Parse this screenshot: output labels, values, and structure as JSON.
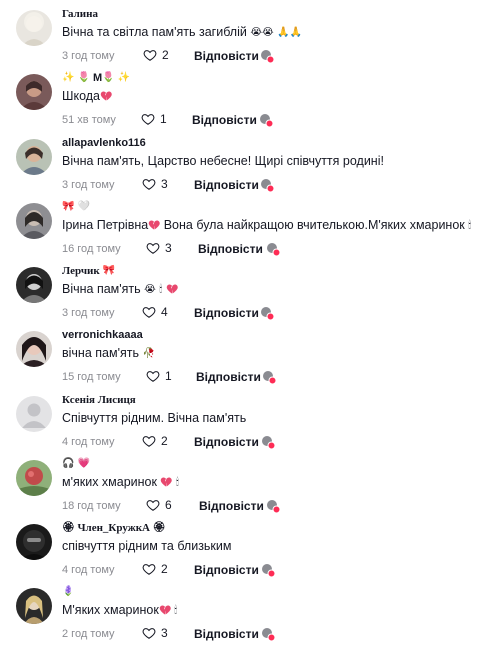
{
  "comments": [
    {
      "name": "Галина",
      "text": "Вічна та світла пам'ять загиблій",
      "time": "3 год тому",
      "likes": "2",
      "reply": "Відповісти"
    },
    {
      "name": "М",
      "text": "Шкода",
      "time": "51 хв тому",
      "likes": "1",
      "reply": "Відповісти"
    },
    {
      "name": "allapavlenko116",
      "text": "Вічна пам'ять, Царство небесне! Щирі співчуття родині!",
      "time": "3 год тому",
      "likes": "3",
      "reply": "Відповісти"
    },
    {
      "name": "",
      "text_a": "Ірина Петрівна",
      "text_b": "Вона була найкращою вчителькою.М'яких хмаринок",
      "time": "16 год тому",
      "likes": "3",
      "reply": "Відповісти"
    },
    {
      "name": "Лерчик",
      "text": "Вічна пам'ять",
      "time": "3 год тому",
      "likes": "4",
      "reply": "Відповісти"
    },
    {
      "name": "verronichkaaaa",
      "text": "вічна пам'ять",
      "time": "15 год тому",
      "likes": "1",
      "reply": "Відповісти"
    },
    {
      "name": "Ксенія Лисиця",
      "text": "Співчуття рідним. Вічна пам'ять",
      "time": "4 год тому",
      "likes": "2",
      "reply": "Відповісти"
    },
    {
      "name": "",
      "text": "м'яких хмаринок",
      "time": "18 год тому",
      "likes": "6",
      "reply": "Відповісти"
    },
    {
      "name": "Член_КружкА",
      "text": "співчуття рідним та близьким",
      "time": "4 год тому",
      "likes": "2",
      "reply": "Відповісти"
    },
    {
      "name": "",
      "text": "М'яких хмаринок",
      "time": "2 год тому",
      "likes": "3",
      "reply": "Відповісти"
    }
  ],
  "icons": {
    "like": "heart-outline-icon",
    "dislike": "thumbs-down-icon"
  },
  "colors": {
    "meta": "#8a8b91",
    "text": "#161823",
    "heart_pink": "#e8486e"
  }
}
